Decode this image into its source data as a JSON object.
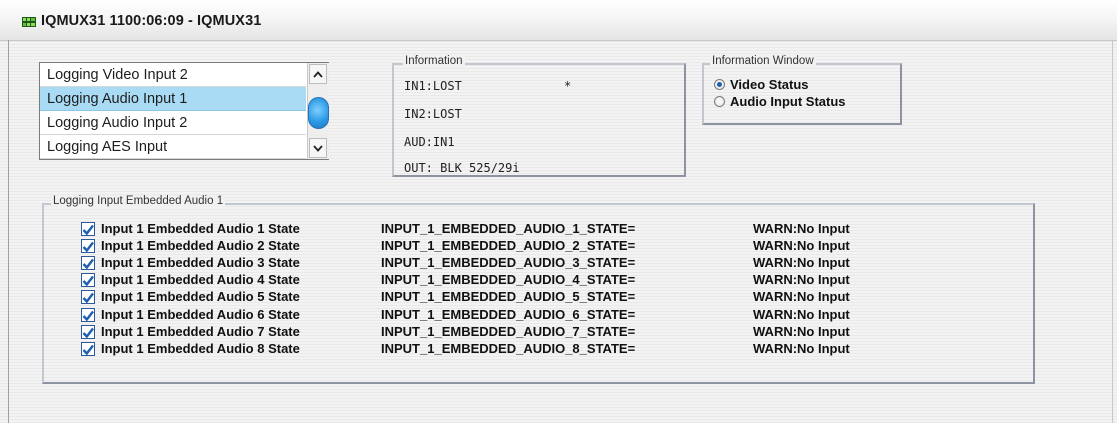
{
  "window": {
    "title": "IQMUX31  1100:06:09  - IQMUX31",
    "icon": "device-grid-icon"
  },
  "log_list": {
    "items": [
      {
        "label": "Logging Video Input 2",
        "selected": false
      },
      {
        "label": "Logging Audio Input 1",
        "selected": true
      },
      {
        "label": "Logging Audio Input 2",
        "selected": false
      },
      {
        "label": "Logging AES Input",
        "selected": false
      }
    ]
  },
  "information": {
    "label": "Information",
    "lines": [
      "IN1:LOST",
      "IN2:LOST",
      "AUD:IN1",
      "OUT: BLK 525/29i"
    ],
    "marker": "*"
  },
  "information_window": {
    "label": "Information Window",
    "options": [
      {
        "label": "Video Status",
        "checked": true
      },
      {
        "label": "Audio Input Status",
        "checked": false
      }
    ]
  },
  "embedded_audio": {
    "label": "Logging Input Embedded Audio 1",
    "rows": [
      {
        "label": "Input 1 Embedded Audio 1 State",
        "key": "INPUT_1_EMBEDDED_AUDIO_1_STATE=",
        "value": "WARN:No Input",
        "checked": true
      },
      {
        "label": "Input 1 Embedded Audio 2 State",
        "key": "INPUT_1_EMBEDDED_AUDIO_2_STATE=",
        "value": "WARN:No Input",
        "checked": true
      },
      {
        "label": "Input 1 Embedded Audio 3 State",
        "key": "INPUT_1_EMBEDDED_AUDIO_3_STATE=",
        "value": "WARN:No Input",
        "checked": true
      },
      {
        "label": "Input 1 Embedded Audio 4 State",
        "key": "INPUT_1_EMBEDDED_AUDIO_4_STATE=",
        "value": "WARN:No Input",
        "checked": true
      },
      {
        "label": "Input 1 Embedded Audio 5 State",
        "key": "INPUT_1_EMBEDDED_AUDIO_5_STATE=",
        "value": "WARN:No Input",
        "checked": true
      },
      {
        "label": "Input 1 Embedded Audio 6 State",
        "key": "INPUT_1_EMBEDDED_AUDIO_6_STATE=",
        "value": "WARN:No Input",
        "checked": true
      },
      {
        "label": "Input 1 Embedded Audio 7 State",
        "key": "INPUT_1_EMBEDDED_AUDIO_7_STATE=",
        "value": "WARN:No Input",
        "checked": true
      },
      {
        "label": "Input 1 Embedded Audio 8 State",
        "key": "INPUT_1_EMBEDDED_AUDIO_8_STATE=",
        "value": "WARN:No Input",
        "checked": true
      }
    ]
  },
  "colors": {
    "selection": "#a9dbf5",
    "checkbox_accent": "#1d5fb0",
    "scroll_thumb": "#2d9be6"
  }
}
